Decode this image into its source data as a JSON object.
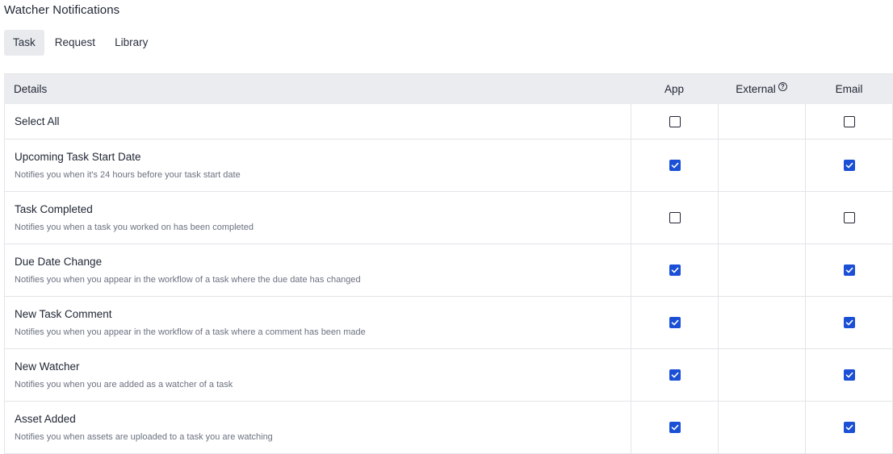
{
  "page": {
    "title": "Watcher Notifications"
  },
  "tabs": [
    {
      "label": "Task",
      "active": true
    },
    {
      "label": "Request",
      "active": false
    },
    {
      "label": "Library",
      "active": false
    }
  ],
  "table": {
    "headers": {
      "details": "Details",
      "app": "App",
      "external": "External",
      "email": "Email"
    },
    "select_all": {
      "label": "Select All",
      "app": false,
      "email": false
    },
    "rows": [
      {
        "title": "Upcoming Task Start Date",
        "description": "Notifies you when it's 24 hours before your task start date",
        "app": true,
        "email": true
      },
      {
        "title": "Task Completed",
        "description": "Notifies you when a task you worked on has been completed",
        "app": false,
        "email": false
      },
      {
        "title": "Due Date Change",
        "description": "Notifies you when you appear in the workflow of a task where the due date has changed",
        "app": true,
        "email": true
      },
      {
        "title": "New Task Comment",
        "description": "Notifies you when you appear in the workflow of a task where a comment has been made",
        "app": true,
        "email": true
      },
      {
        "title": "New Watcher",
        "description": "Notifies you when you are added as a watcher of a task",
        "app": true,
        "email": true
      },
      {
        "title": "Asset Added",
        "description": "Notifies you when assets are uploaded to a task you are watching",
        "app": true,
        "email": true
      }
    ]
  },
  "colors": {
    "accent": "#1a4fd6",
    "header_bg": "#ebecf0",
    "tab_active_bg": "#e9eaee"
  }
}
